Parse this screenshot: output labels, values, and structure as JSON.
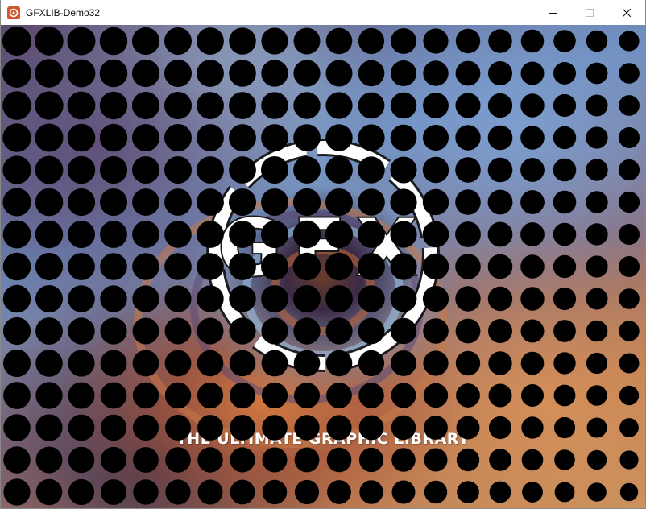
{
  "window": {
    "title": "GFXLIB-Demo32",
    "icon": "gfx-app-icon",
    "controls": [
      "minimize-icon",
      "maximize-icon",
      "close-icon"
    ]
  },
  "demo": {
    "logo_text": "GFX",
    "tagline": "THE ULTIMATE GRAPHIC LIBRARY",
    "dot_color": "#000000",
    "logo_color": "#ffffff"
  }
}
